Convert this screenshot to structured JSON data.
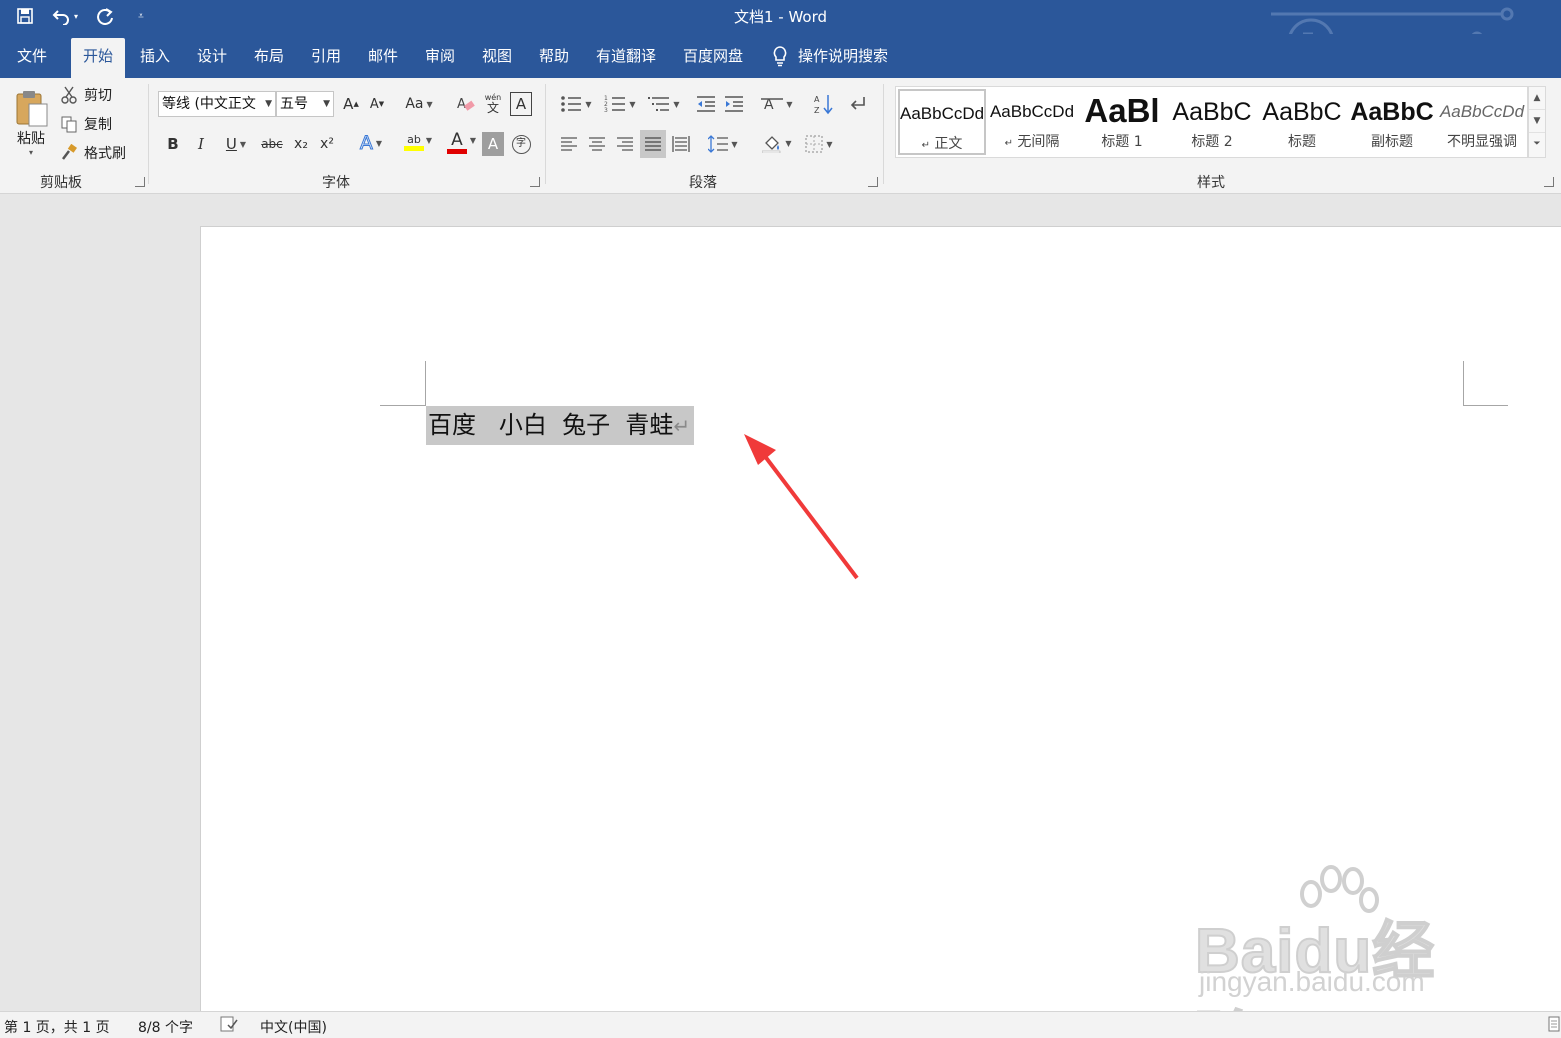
{
  "window": {
    "title": "文档1  -  Word"
  },
  "quick_access": {
    "save": "save-icon",
    "undo": "undo-icon",
    "redo": "redo-icon",
    "customize": "customize-icon"
  },
  "tabs": [
    {
      "label": "文件"
    },
    {
      "label": "开始"
    },
    {
      "label": "插入"
    },
    {
      "label": "设计"
    },
    {
      "label": "布局"
    },
    {
      "label": "引用"
    },
    {
      "label": "邮件"
    },
    {
      "label": "审阅"
    },
    {
      "label": "视图"
    },
    {
      "label": "帮助"
    },
    {
      "label": "有道翻译"
    },
    {
      "label": "百度网盘"
    }
  ],
  "tell_me": {
    "label": "操作说明搜索"
  },
  "clipboard": {
    "paste": "粘贴",
    "cut": "剪切",
    "copy": "复制",
    "format_painter": "格式刷",
    "group": "剪贴板"
  },
  "font": {
    "name": "等线 (中文正文",
    "size": "五号",
    "grow": "A",
    "shrink": "A",
    "change_case": "Aa",
    "phonetic_top": "wén",
    "phonetic_bottom": "文",
    "char_border": "A",
    "bold": "B",
    "italic": "I",
    "underline": "U",
    "strike": "abc",
    "subscript": "x₂",
    "superscript": "x²",
    "effects": "A",
    "highlight": "ab",
    "font_color": "A",
    "shading": "A",
    "enclose": "字",
    "group": "字体",
    "highlight_color": "#ffff00",
    "font_color_value": "#e00000"
  },
  "paragraph": {
    "group": "段落"
  },
  "styles": {
    "group": "样式",
    "items": [
      {
        "sample": "AaBbCcDd",
        "name": "正文",
        "mark": "↵"
      },
      {
        "sample": "AaBbCcDd",
        "name": "无间隔",
        "mark": "↵"
      },
      {
        "sample": "AaBl",
        "name": "标题 1",
        "mark": ""
      },
      {
        "sample": "AaBbC",
        "name": "标题 2",
        "mark": ""
      },
      {
        "sample": "AaBbC",
        "name": "标题",
        "mark": ""
      },
      {
        "sample": "AaBbC",
        "name": "副标题",
        "mark": ""
      },
      {
        "sample": "AaBbCcDd",
        "name": "不明显强调",
        "mark": ""
      }
    ]
  },
  "document": {
    "text": "百度   小白  兔子  青蛙",
    "paragraph_mark": "↵"
  },
  "annotation": {
    "arrow_color": "#f03a3a"
  },
  "watermark": {
    "big": "Baidu经验",
    "small": "jingyan.baidu.com"
  },
  "status": {
    "page": "第 1 页，共 1 页",
    "words": "8/8 个字",
    "language": "中文(中国)"
  },
  "colors": {
    "brand": "#2b579a",
    "ribbon_bg": "#f3f3f3",
    "selection": "#c8c8c8"
  }
}
